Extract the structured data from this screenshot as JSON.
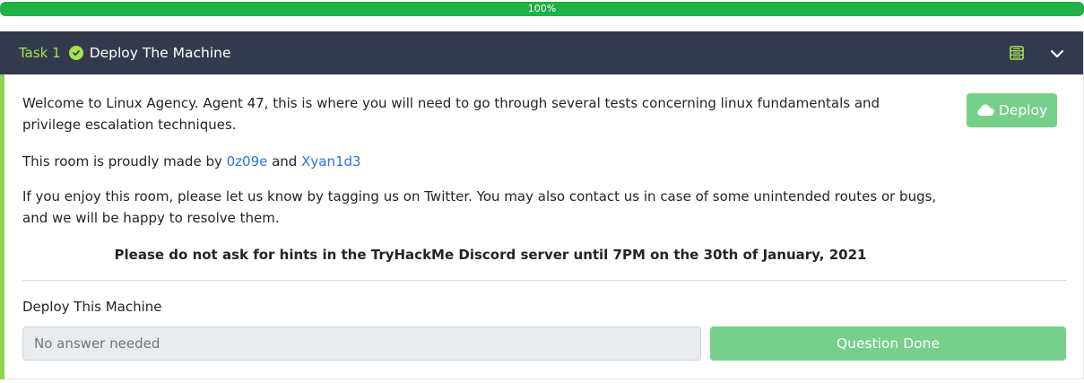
{
  "progress": {
    "percent": 100,
    "label": "100%"
  },
  "task": {
    "number_label": "Task 1",
    "title": "Deploy The Machine",
    "completed": true
  },
  "content": {
    "intro": "Welcome to Linux Agency. Agent 47, this is where you will need to go through several tests concerning linux fundamentals and privilege escalation techniques.",
    "credits_prefix": "This room is proudly made by ",
    "author1": "0z09e",
    "credits_and": " and ",
    "author2": "Xyan1d3",
    "contact": "If you enjoy this room, please let us know by tagging us on Twitter. You may also contact us in case of some unintended routes or bugs, and we will be happy to resolve them.",
    "notice": "Please do not ask for hints in the TryHackMe Discord server until 7PM on the 30th of January, 2021"
  },
  "deploy_button": {
    "label": "Deploy",
    "icon": "cloud-icon"
  },
  "question": {
    "label": "Deploy This Machine",
    "placeholder": "No answer needed",
    "done_label": "Question Done"
  },
  "colors": {
    "progress": "#1fb046",
    "header_bg": "#343a4e",
    "accent_green": "#a5e34d",
    "button_green": "#76d08a",
    "link": "#2b72e6"
  }
}
